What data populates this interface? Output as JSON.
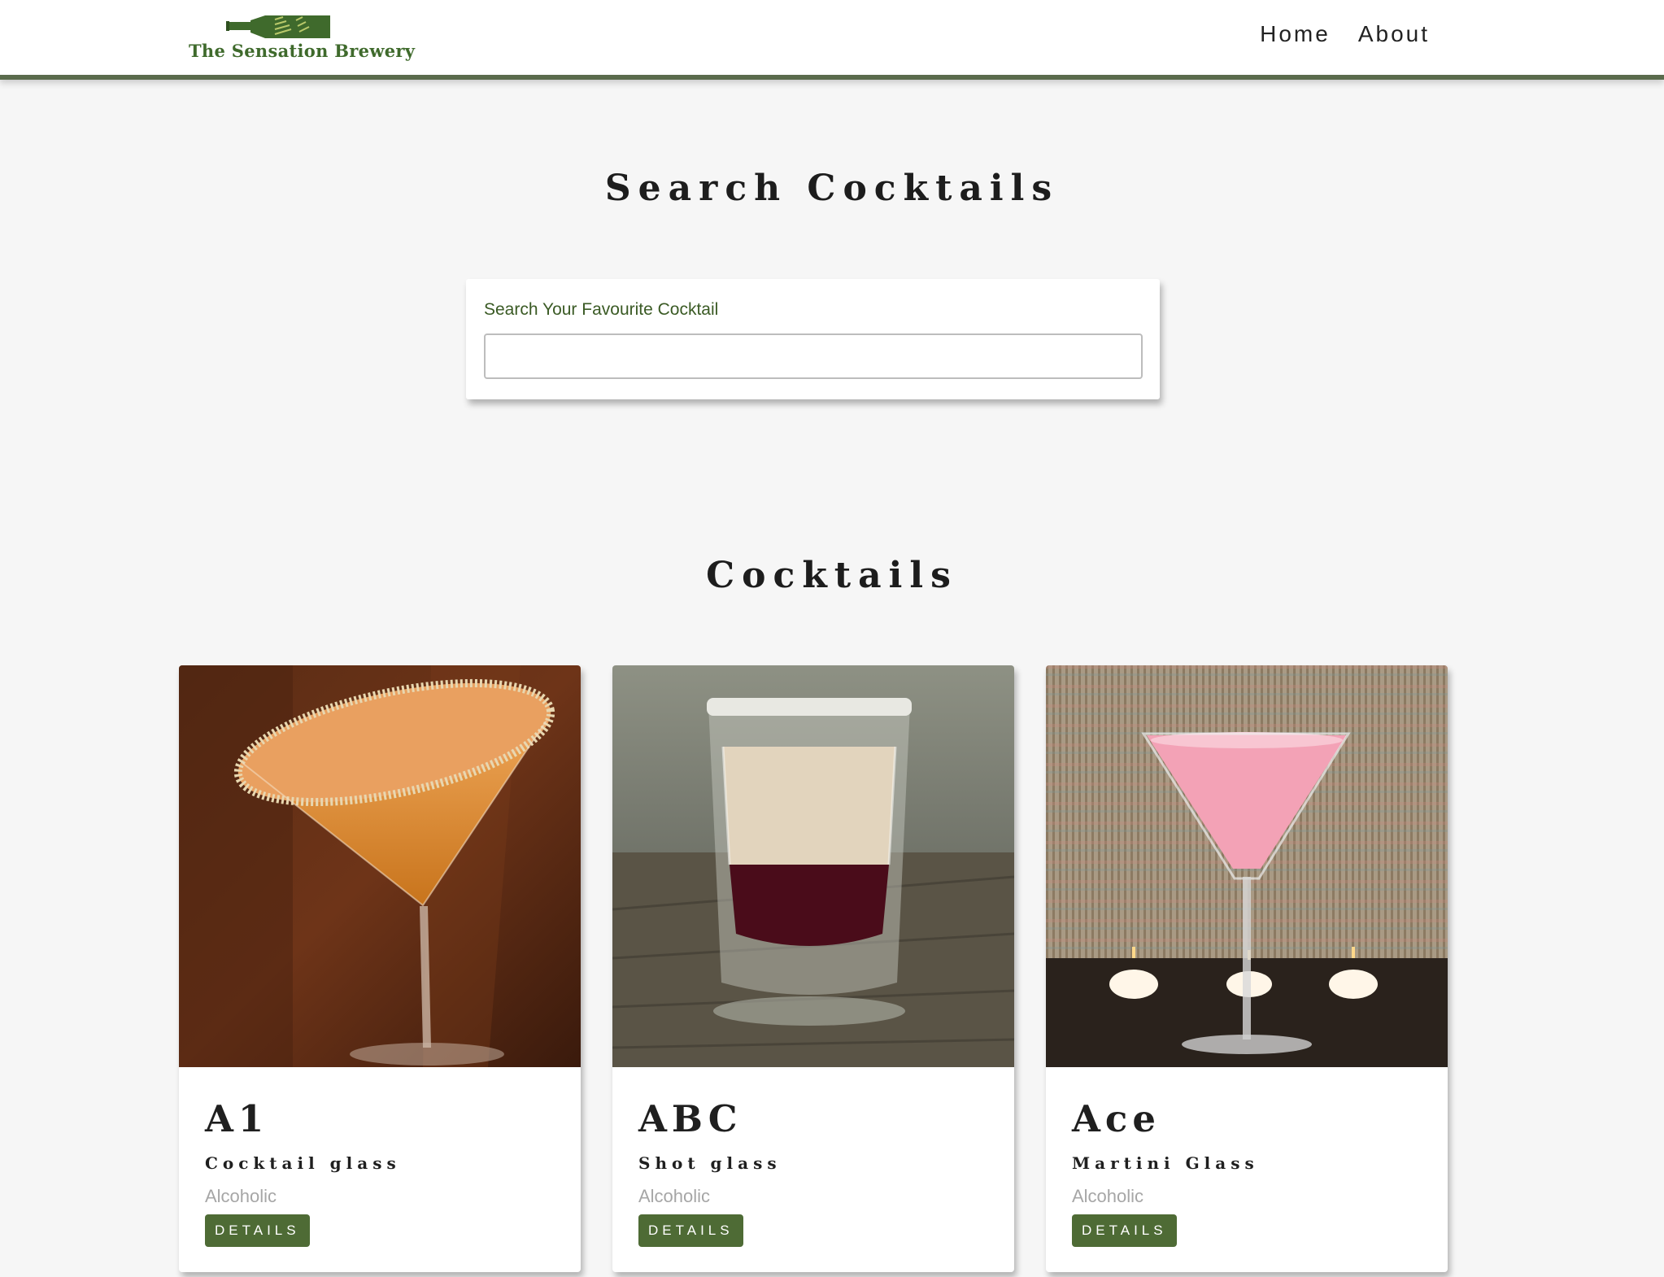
{
  "brand": {
    "logo_text": "The Sensation Brewery",
    "accent_color": "#4e6b35"
  },
  "nav": {
    "links": [
      {
        "label": "Home"
      },
      {
        "label": "About"
      }
    ]
  },
  "search_section": {
    "title": "Search Cocktails",
    "label": "Search Your Favourite Cocktail",
    "input_value": ""
  },
  "cocktails_section": {
    "title": "Cocktails",
    "items": [
      {
        "name": "A1",
        "glass": "Cocktail glass",
        "type": "Alcoholic",
        "button": "DETAILS",
        "image": "orange-martini-sugar-rim"
      },
      {
        "name": "ABC",
        "glass": "Shot glass",
        "type": "Alcoholic",
        "button": "DETAILS",
        "image": "layered-shot"
      },
      {
        "name": "Ace",
        "glass": "Martini Glass",
        "type": "Alcoholic",
        "button": "DETAILS",
        "image": "pink-martini-candles"
      }
    ]
  }
}
